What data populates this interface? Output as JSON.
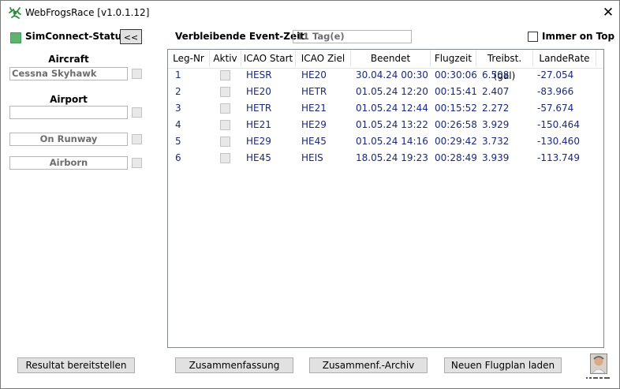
{
  "window": {
    "title": "WebFrogsRace [v1.0.1.12]",
    "close_glyph": "✕"
  },
  "status": {
    "label": "SimConnect-Status",
    "collapse_label": "<<",
    "led_color": "#5fb371"
  },
  "left": {
    "aircraft_label": "Aircraft",
    "aircraft_value": "Cessna Skyhawk",
    "airport_label": "Airport",
    "airport_value": "",
    "runway_value": "On Runway",
    "airborn_value": "Airborn"
  },
  "event": {
    "label": "Verbleibende Event-Zeit:",
    "value": "11 Tag(e)"
  },
  "always_on_top": {
    "label": "Immer on Top",
    "checked": false
  },
  "table": {
    "columns": [
      "Leg-Nr",
      "Aktiv",
      "ICAO Start",
      "ICAO Ziel",
      "Beendet",
      "Flugzeit",
      "Treibst. (gal)",
      "LandeRate"
    ],
    "rows": [
      [
        "1",
        "",
        "HESR",
        "HE20",
        "30.04.24 00:30",
        "00:30:06",
        "6.508",
        "-27.054"
      ],
      [
        "2",
        "",
        "HE20",
        "HETR",
        "01.05.24 12:20",
        "00:15:41",
        "2.407",
        "-83.966"
      ],
      [
        "3",
        "",
        "HETR",
        "HE21",
        "01.05.24 12:44",
        "00:15:52",
        "2.272",
        "-57.674"
      ],
      [
        "4",
        "",
        "HE21",
        "HE29",
        "01.05.24 13:22",
        "00:26:58",
        "3.929",
        "-150.464"
      ],
      [
        "5",
        "",
        "HE29",
        "HE45",
        "01.05.24 14:16",
        "00:29:42",
        "3.732",
        "-130.460"
      ],
      [
        "6",
        "",
        "HE45",
        "HEIS",
        "18.05.24 19:23",
        "00:28:49",
        "3.939",
        "-113.749"
      ]
    ]
  },
  "buttons": {
    "result": "Resultat bereitstellen",
    "summary": "Zusammenfassung",
    "summary_archive": "Zusammenf.-Archiv",
    "load_plan": "Neuen Flugplan laden"
  },
  "colors": {
    "row_text": "#1a2a7a",
    "accent": "#5fb371"
  }
}
